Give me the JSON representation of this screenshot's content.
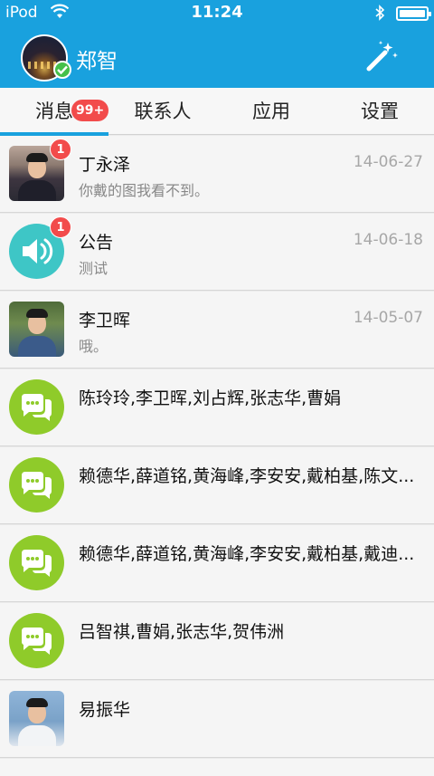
{
  "status_bar": {
    "carrier": "iPod",
    "time": "11:24"
  },
  "header": {
    "user_name": "郑智",
    "action_icon": "magic-wand-icon"
  },
  "tabs": [
    {
      "label": "消息",
      "badge": "99+"
    },
    {
      "label": "联系人"
    },
    {
      "label": "应用"
    },
    {
      "label": "设置"
    }
  ],
  "conversations": [
    {
      "name": "丁永泽",
      "message": "你戴的图我看不到。",
      "date": "14-06-27",
      "unread": "1",
      "avatar": "photo"
    },
    {
      "name": "公告",
      "message": "测试",
      "date": "14-06-18",
      "unread": "1",
      "avatar": "speaker-icon"
    },
    {
      "name": "李卫晖",
      "message": "哦。",
      "date": "14-05-07",
      "avatar": "photo"
    },
    {
      "name": "陈玲玲,李卫晖,刘占辉,张志华,曹娟",
      "avatar": "group-chat-icon"
    },
    {
      "name": "赖德华,薛道铭,黄海峰,李安安,戴柏基,陈文...",
      "avatar": "group-chat-icon"
    },
    {
      "name": "赖德华,薛道铭,黄海峰,李安安,戴柏基,戴迪...",
      "avatar": "group-chat-icon"
    },
    {
      "name": "吕智祺,曹娟,张志华,贺伟洲",
      "avatar": "group-chat-icon"
    },
    {
      "name": "易振华",
      "avatar": "photo"
    }
  ],
  "colors": {
    "brand": "#19a1de",
    "badge": "#f24b4b",
    "group_icon": "#8fcb2a",
    "speaker_icon": "#3ec6c6"
  }
}
